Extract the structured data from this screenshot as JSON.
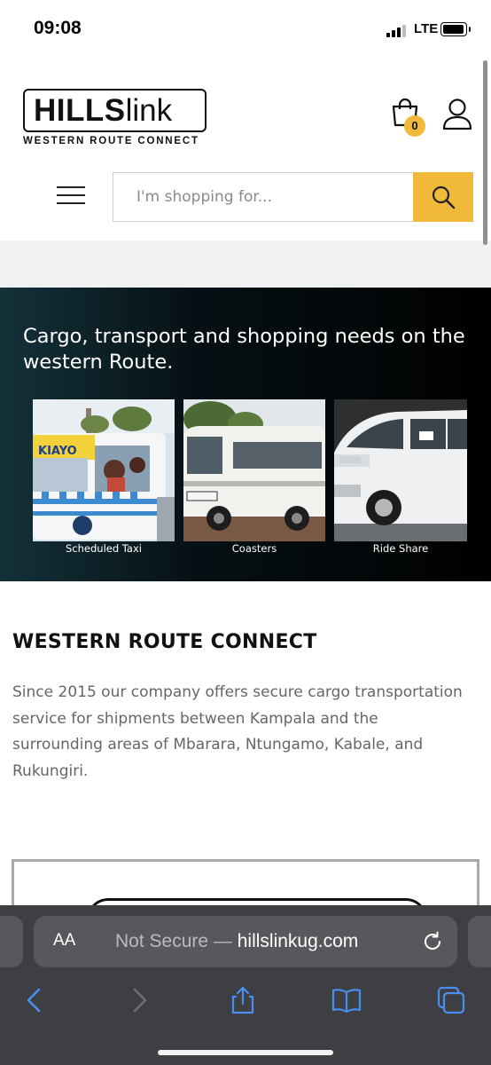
{
  "status_bar": {
    "time": "09:08",
    "network": "LTE"
  },
  "header": {
    "logo_bold": "HILLS",
    "logo_light": "link",
    "logo_tagline": "WESTERN ROUTE CONNECT",
    "cart_count": "0",
    "search_placeholder": "I'm shopping for..."
  },
  "hero": {
    "title": "Cargo, transport and shopping needs on the western Route.",
    "tiles": [
      {
        "label": "Scheduled Taxi"
      },
      {
        "label": "Coasters"
      },
      {
        "label": "Ride Share"
      }
    ]
  },
  "about": {
    "title": "WESTERN ROUTE CONNECT",
    "text": "Since 2015 our  company offers  secure cargo transportation service for shipments between Kampala and the surrounding areas of Mbarara, Ntungamo, Kabale, and Rukungiri."
  },
  "browser": {
    "aa_label": "AA",
    "security_label": "Not Secure —",
    "domain": "hillslinkug.com"
  },
  "colors": {
    "accent": "#f0b93a",
    "hero_bg": "#000000",
    "toolbar_bg": "#3d3f42",
    "toolbar_icon": "#4a8ff0"
  },
  "icons": {
    "cart": "shopping-bag-icon",
    "user": "user-icon",
    "menu": "hamburger-menu-icon",
    "search": "search-icon",
    "reload": "reload-icon",
    "back": "chevron-left-icon",
    "forward": "chevron-right-icon",
    "share": "share-icon",
    "bookmarks": "book-icon",
    "tabs": "tabs-icon"
  }
}
